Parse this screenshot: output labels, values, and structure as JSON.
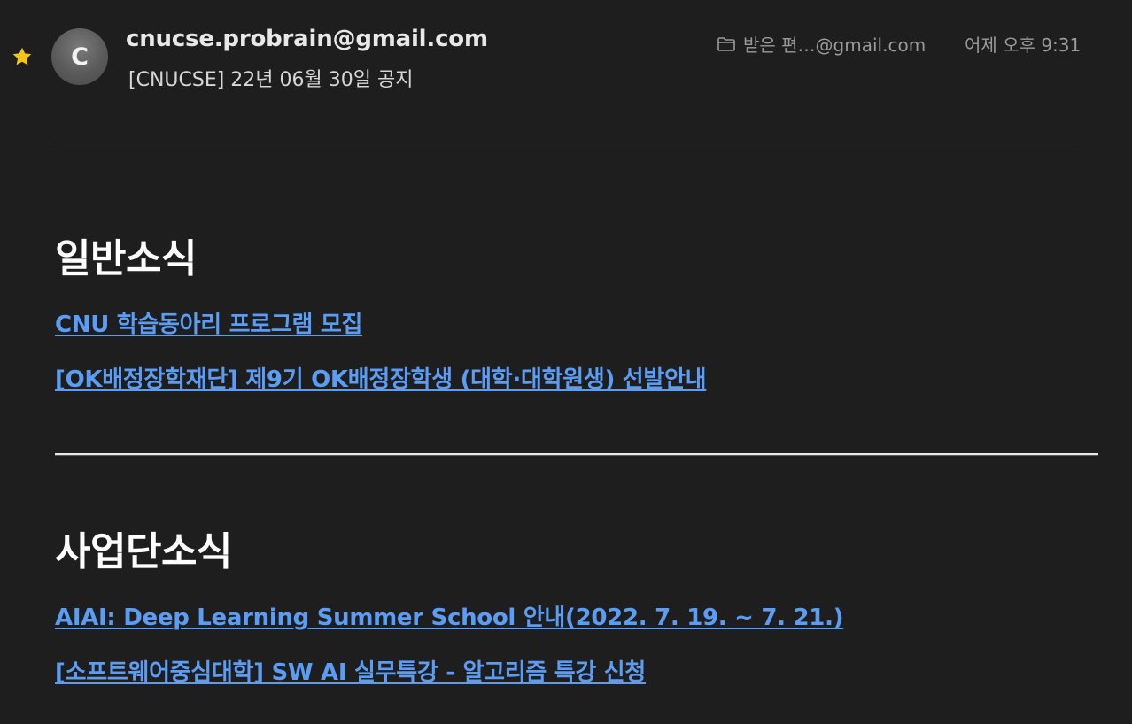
{
  "header": {
    "avatar_initial": "C",
    "sender": "cnucse.probrain@gmail.com",
    "subject": "[CNUCSE] 22년 06월 30일 공지",
    "folder_icon": "folder-icon",
    "mailbox": "받은 편…@gmail.com",
    "timestamp": "어제 오후 9:31",
    "star_icon": "star-icon",
    "star_color": "#f5c518"
  },
  "body": {
    "sections": [
      {
        "title": "일반소식",
        "links": [
          "CNU 학습동아리 프로그램 모집",
          "[OK배정장학재단] 제9기 OK배정장학생 (대학·대학원생) 선발안내"
        ]
      },
      {
        "title": "사업단소식",
        "links": [
          "AIAI: Deep Learning Summer School 안내(2022. 7. 19. ~ 7. 21.)",
          "[소프트웨어중심대학] SW AI 실무특강 - 알고리즘 특강 신청"
        ]
      }
    ]
  },
  "colors": {
    "background": "#1e1e1e",
    "link": "#5b9cf5",
    "heading": "#ffffff",
    "muted": "#9a9a9a"
  }
}
